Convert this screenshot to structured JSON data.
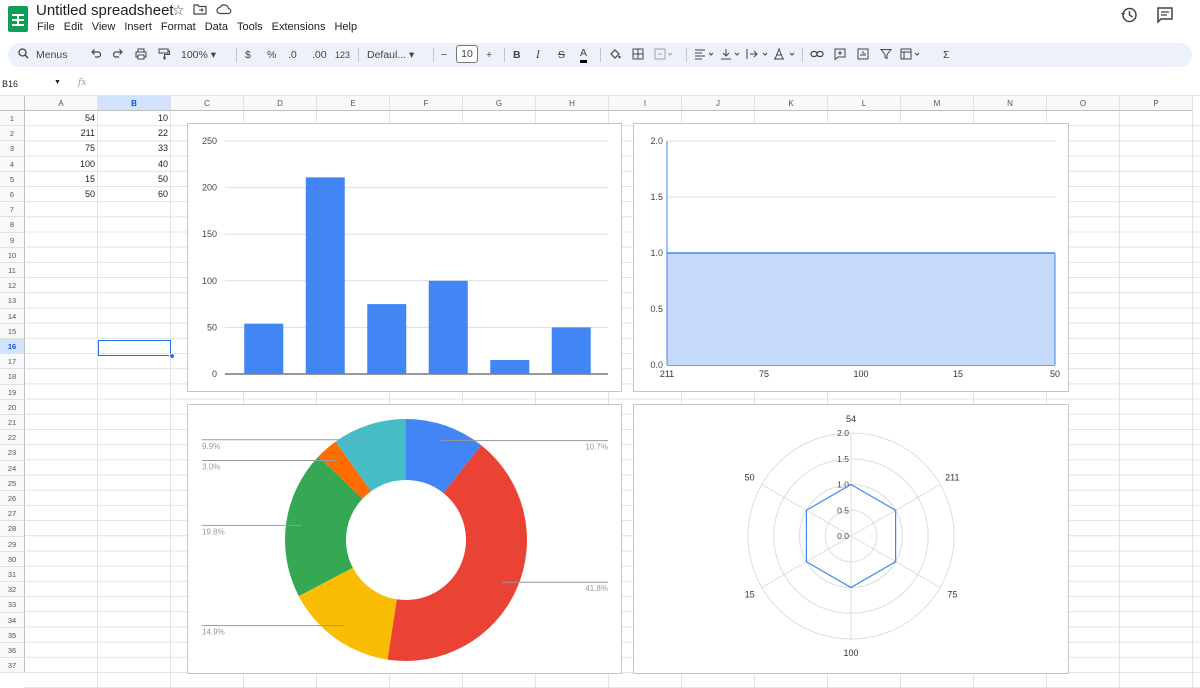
{
  "app": {
    "title": "Untitled spreadsheet",
    "menus": [
      "File",
      "Edit",
      "View",
      "Insert",
      "Format",
      "Data",
      "Tools",
      "Extensions",
      "Help"
    ]
  },
  "toolbar": {
    "menus_label": "Menus",
    "zoom": "100%",
    "currency": "$",
    "percent": "%",
    "decrease_decimal": ".0",
    "increase_decimal": ".00",
    "number_format": "123",
    "font": "Defaul...",
    "font_size": "10",
    "minus": "−",
    "plus": "+",
    "bold": "B",
    "italic": "I",
    "strike": "S",
    "text_color": "A",
    "sum": "Σ"
  },
  "formula_bar": {
    "cell_ref": "B16",
    "fx": "fx"
  },
  "sheet": {
    "columns": [
      "A",
      "B",
      "C",
      "D",
      "E",
      "F",
      "G",
      "H",
      "I",
      "J",
      "K",
      "L",
      "M",
      "N",
      "O",
      "P"
    ],
    "selected_column": "B",
    "selected_row": 16,
    "row_count": 37,
    "data": [
      {
        "a": "54",
        "b": "10"
      },
      {
        "a": "211",
        "b": "22"
      },
      {
        "a": "75",
        "b": "33"
      },
      {
        "a": "100",
        "b": "40"
      },
      {
        "a": "15",
        "b": "50"
      },
      {
        "a": "50",
        "b": "60"
      }
    ]
  },
  "chart_data": [
    {
      "type": "bar",
      "categories": [
        "",
        "",
        "",
        "",
        "",
        ""
      ],
      "values": [
        54,
        211,
        75,
        100,
        15,
        50
      ],
      "ylim": [
        0,
        250
      ],
      "yticks": [
        "0",
        "50",
        "100",
        "150",
        "200",
        "250"
      ],
      "grid": true,
      "color": "#4285f4"
    },
    {
      "type": "area",
      "categories": [
        "211",
        "75",
        "100",
        "15",
        "50"
      ],
      "values": [
        1,
        1,
        1,
        1,
        1
      ],
      "ylim": [
        0,
        2
      ],
      "yticks": [
        "0.0",
        "0.5",
        "1.0",
        "1.5",
        "2.0"
      ],
      "grid": true,
      "color": "#4285f4"
    },
    {
      "type": "pie",
      "donut": true,
      "values": [
        10,
        22,
        33,
        40,
        50,
        60
      ],
      "labels": [
        "9.9%",
        "3.0%",
        "19.8%",
        "14.9%",
        "41.8%",
        "10.7%"
      ],
      "slices": [
        {
          "value": 10.7,
          "label": "10.7%",
          "color": "#4285f4"
        },
        {
          "value": 41.8,
          "label": "41.8%",
          "color": "#ea4335"
        },
        {
          "value": 14.9,
          "label": "14.9%",
          "color": "#fbbc04"
        },
        {
          "value": 19.8,
          "label": "19.8%",
          "color": "#34a853"
        },
        {
          "value": 3.0,
          "label": "3.0%",
          "color": "#ff6d01"
        },
        {
          "value": 9.9,
          "label": "9.9%",
          "color": "#46bdc6"
        }
      ]
    },
    {
      "type": "radar",
      "axes": [
        "54",
        "211",
        "75",
        "100",
        "15",
        "50"
      ],
      "values": [
        1,
        1,
        1,
        1,
        1,
        1
      ],
      "rlim": [
        0,
        2
      ],
      "rticks": [
        "0.0",
        "0.5",
        "1.0",
        "1.5",
        "2.0"
      ],
      "color": "#4285f4"
    }
  ]
}
